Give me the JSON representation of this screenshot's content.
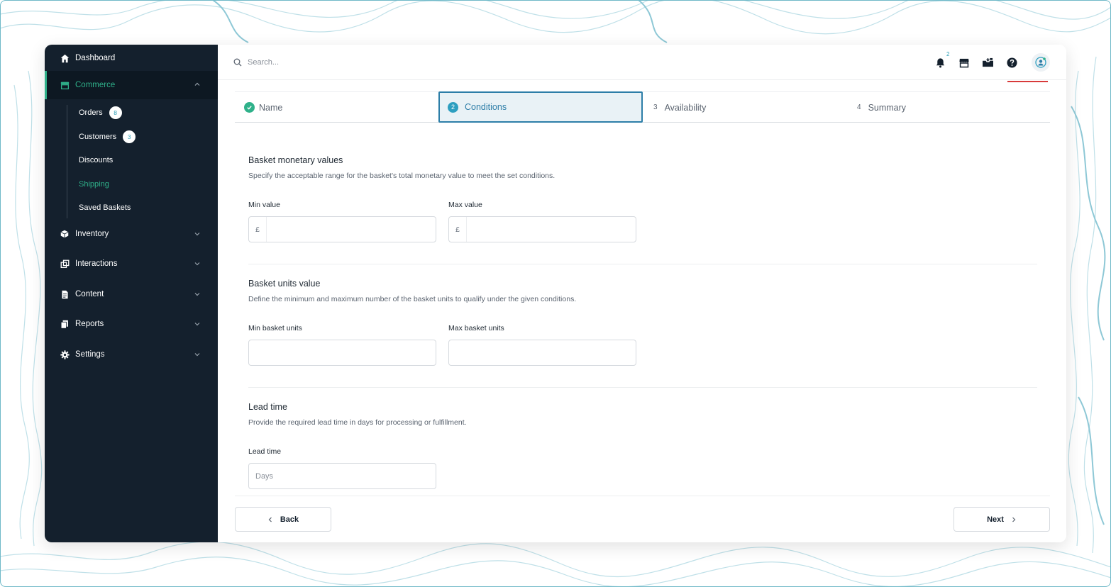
{
  "sidebar": {
    "items": [
      {
        "label": "Dashboard",
        "icon": "home-icon"
      },
      {
        "label": "Commerce",
        "icon": "store-icon",
        "active": true,
        "expanded": true
      },
      {
        "label": "Inventory",
        "icon": "box-icon"
      },
      {
        "label": "Interactions",
        "icon": "interactions-icon"
      },
      {
        "label": "Content",
        "icon": "document-icon"
      },
      {
        "label": "Reports",
        "icon": "reports-icon"
      },
      {
        "label": "Settings",
        "icon": "gear-icon"
      }
    ],
    "commerce_sub": [
      {
        "label": "Orders",
        "badge": "8"
      },
      {
        "label": "Customers",
        "badge": "3"
      },
      {
        "label": "Discounts"
      },
      {
        "label": "Shipping",
        "active": true
      },
      {
        "label": "Saved Baskets"
      }
    ]
  },
  "topbar": {
    "search_placeholder": "Search...",
    "notification_count": "2",
    "icons": [
      "bell-icon",
      "store-icon",
      "inbox-icon",
      "help-icon",
      "user-avatar-icon"
    ]
  },
  "stepper": {
    "steps": [
      {
        "number": "",
        "label": "Name",
        "state": "complete"
      },
      {
        "number": "2",
        "label": "Conditions",
        "state": "active"
      },
      {
        "number": "3",
        "label": "Availability",
        "state": "upcoming"
      },
      {
        "number": "4",
        "label": "Summary",
        "state": "upcoming"
      }
    ]
  },
  "form": {
    "monetary": {
      "title": "Basket monetary values",
      "description": "Specify the acceptable range for the basket's total monetary value to meet the set conditions.",
      "min_label": "Min value",
      "max_label": "Max value",
      "currency_prefix": "£",
      "min_value": "",
      "max_value": ""
    },
    "units": {
      "title": "Basket units value",
      "description": "Define the minimum and maximum number of the basket units to qualify under the given conditions.",
      "min_label": "Min basket units",
      "max_label": "Max basket units",
      "min_value": "",
      "max_value": ""
    },
    "lead_time": {
      "title": "Lead time",
      "description": "Provide the required lead time in days for processing or fulfillment.",
      "label": "Lead time",
      "placeholder": "Days",
      "value": ""
    }
  },
  "footer": {
    "back_label": "Back",
    "next_label": "Next"
  },
  "colors": {
    "sidebar_bg": "#14202d",
    "accent_green": "#2fb18a",
    "accent_blue": "#2d7ea8",
    "topo_lines": "#9fd0dc"
  }
}
